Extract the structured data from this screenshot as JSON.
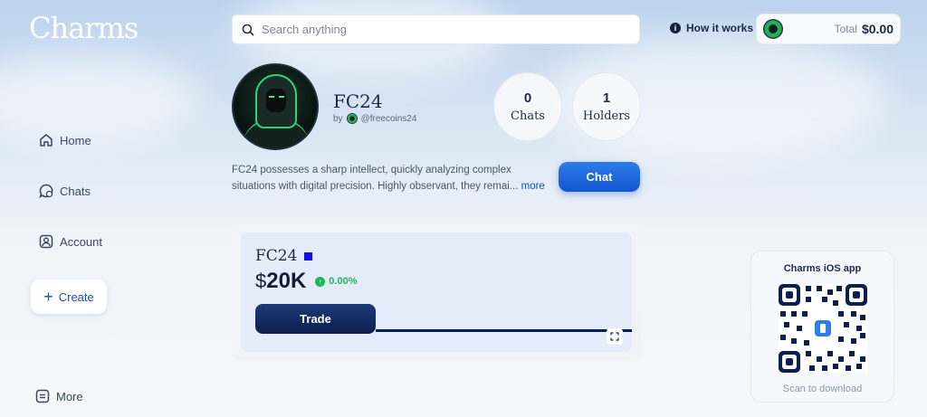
{
  "app": {
    "logo": "Charms"
  },
  "search": {
    "placeholder": "Search anything"
  },
  "header": {
    "how_it_works": "How it works",
    "total_label": "Total",
    "total_value": "$0.00"
  },
  "sidebar": {
    "items": [
      {
        "label": "Home",
        "icon": "home-icon"
      },
      {
        "label": "Chats",
        "icon": "chat-bubble-icon"
      },
      {
        "label": "Account",
        "icon": "account-icon"
      }
    ],
    "create_label": "Create",
    "more_label": "More"
  },
  "profile": {
    "title": "FC24",
    "by_label": "by",
    "handle": "@freecoins24",
    "description": "FC24 possesses a sharp intellect, quickly analyzing complex situations with digital precision. Highly observant, they remai...",
    "more_link": "more",
    "chat_button": "Chat"
  },
  "stats": [
    {
      "value": "0",
      "label": "Chats"
    },
    {
      "value": "1",
      "label": "Holders"
    }
  ],
  "token_card": {
    "name": "FC24",
    "price_symbol": "$",
    "price_value": "20K",
    "change": "0.00%",
    "trade_button": "Trade",
    "change_color": "#1fb55a",
    "accent_color": "#1010e0"
  },
  "ios_app": {
    "title": "Charms iOS app",
    "caption": "Scan to download"
  }
}
